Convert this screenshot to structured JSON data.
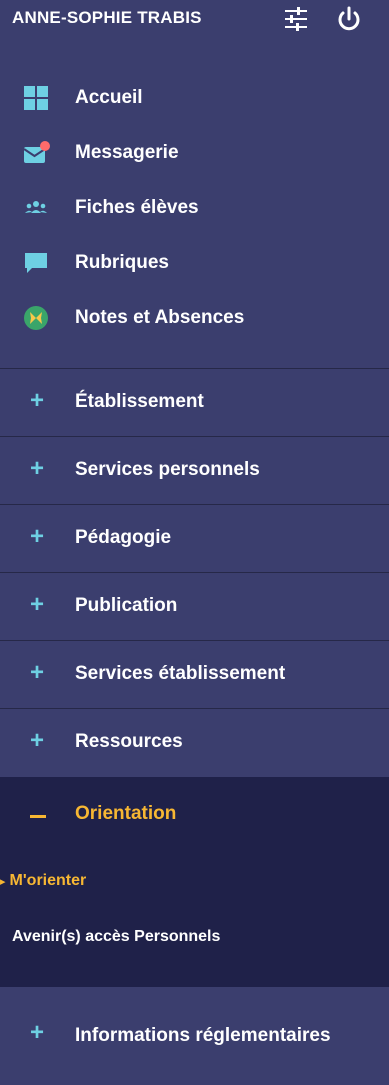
{
  "header": {
    "user_name": "ANNE-SOPHIE TRABIS",
    "icons": [
      "settings-sliders-icon",
      "power-icon"
    ]
  },
  "quick_links": [
    {
      "label": "Accueil",
      "icon": "grid-icon"
    },
    {
      "label": "Messagerie",
      "icon": "mail-notification-icon"
    },
    {
      "label": "Fiches élèves",
      "icon": "students-icon"
    },
    {
      "label": "Rubriques",
      "icon": "chat-bubble-icon"
    },
    {
      "label": "Notes et Absences",
      "icon": "butterfly-icon"
    }
  ],
  "sections": [
    {
      "label": "Établissement"
    },
    {
      "label": "Services personnels"
    },
    {
      "label": "Pédagogie"
    },
    {
      "label": "Publication"
    },
    {
      "label": "Services établissement"
    },
    {
      "label": "Ressources"
    }
  ],
  "orientation": {
    "label": "Orientation",
    "items": [
      {
        "label": "M'orienter"
      },
      {
        "label": "Avenir(s) accès Personnels"
      }
    ]
  },
  "info": {
    "label": "Informations réglementaires"
  },
  "colors": {
    "background": "#3b3e6e",
    "active_background": "#1f2149",
    "accent": "#f7b733",
    "plus": "#6ed0e3"
  }
}
